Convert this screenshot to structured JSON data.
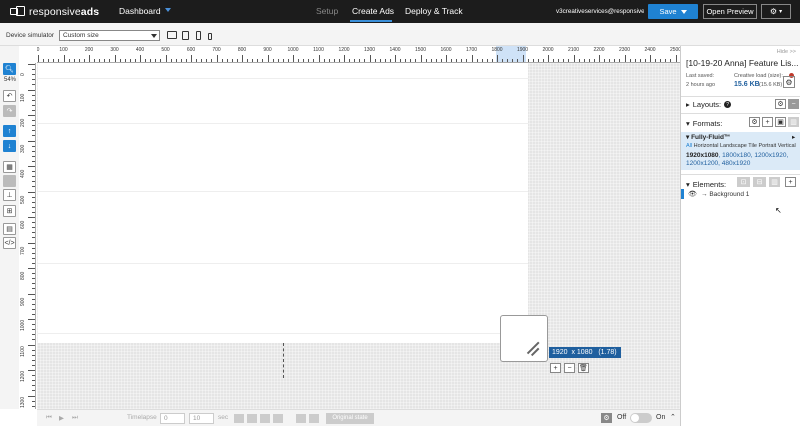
{
  "nav": {
    "logo_light": "responsive",
    "logo_bold": "ads",
    "dashboard": "Dashboard",
    "tabs": [
      "Setup",
      "Create Ads",
      "Deploy & Track"
    ],
    "email": "v3creativeservices@responsivea...",
    "save": "Save",
    "open_preview": "Open Preview",
    "settings_icon": "gear-icon"
  },
  "device": {
    "label": "Device simulator",
    "selected": "Custom size"
  },
  "tools": {
    "zoom": "54%"
  },
  "rulers": {
    "h_labels": [
      "0",
      "100",
      "200",
      "300",
      "400",
      "500",
      "600",
      "700",
      "800",
      "900",
      "1000",
      "1100",
      "1200",
      "1300",
      "1400",
      "1500",
      "1600",
      "1700",
      "1800",
      "1900",
      "2000",
      "2100",
      "2200",
      "2300",
      "2400",
      "2500"
    ],
    "v_labels": [
      "0",
      "100",
      "200",
      "300",
      "400",
      "500",
      "600",
      "700",
      "800",
      "900",
      "1000",
      "1100",
      "1200",
      "1300"
    ]
  },
  "canvas": {
    "dimensions": "1920  x 1080   (1.78)"
  },
  "timeline": {
    "timelapse_label": "Timelapse",
    "start": "0",
    "end": "10",
    "unit": "sec",
    "original_state": "Original state",
    "toggle_off": "Off",
    "toggle_on": "On"
  },
  "panel": {
    "hide": "Hide >>",
    "title": "[10-19-20 Anna] Feature Lis...",
    "last_saved_label": "Last saved:",
    "last_saved_value": "2 hours ago",
    "load_label": "Creative load (size):",
    "load_value": "15.6 KB",
    "load_sub": "(15.6 KB)",
    "layouts": "Layouts:",
    "formats": "Formats:",
    "format_name": "Fully-Fluid™",
    "format_filter_all": "All",
    "format_filter_rest": "Horizontal Landscape Tile Portrait Vertical",
    "format_sizes_bold": "1920x1080",
    "format_sizes_rest": ", 1800x180, 1200x1920, 1200x1200, 480x1920",
    "elements": "Elements:",
    "element_1": "Background 1"
  }
}
